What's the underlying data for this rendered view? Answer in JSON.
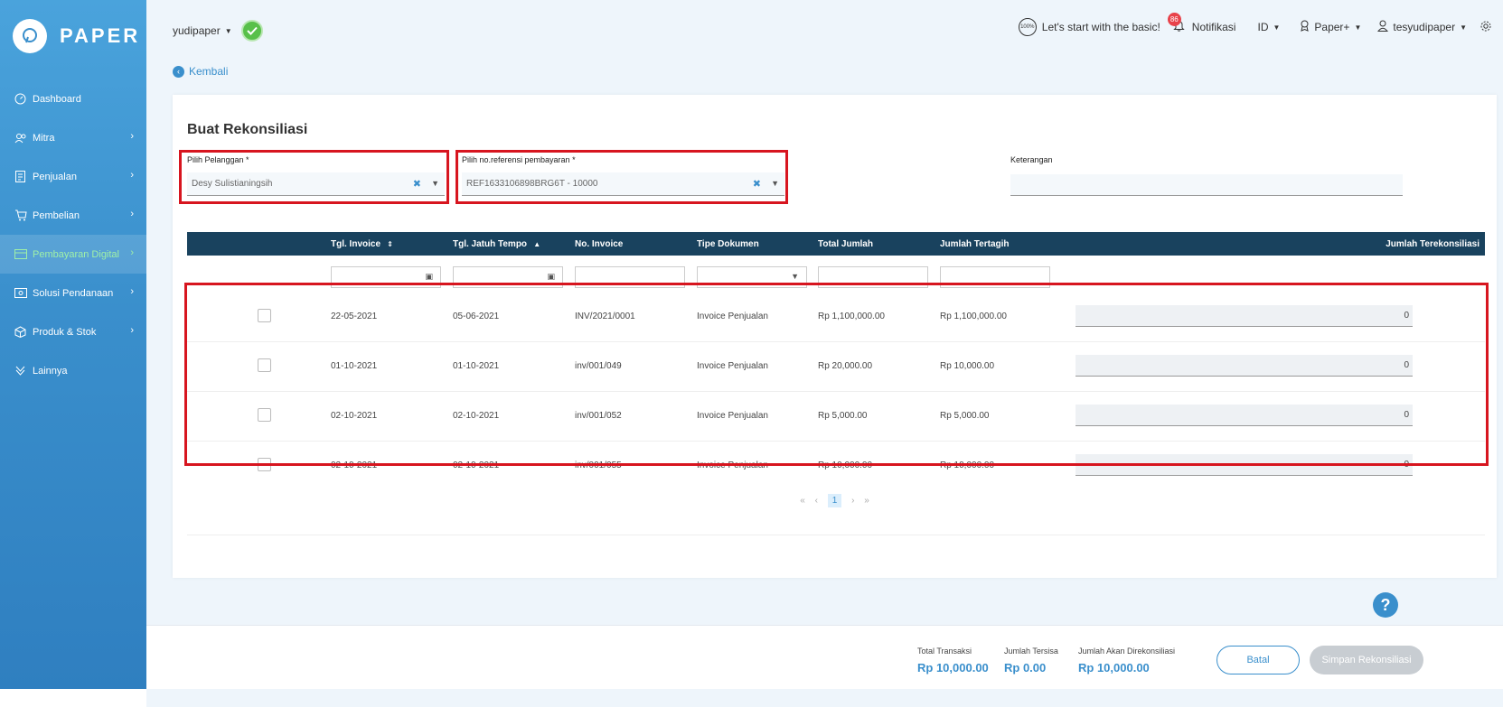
{
  "brand": {
    "name": "PAPER"
  },
  "sidebar": {
    "items": [
      {
        "label": "Dashboard"
      },
      {
        "label": "Mitra"
      },
      {
        "label": "Penjualan"
      },
      {
        "label": "Pembelian"
      },
      {
        "label": "Pembayaran Digital"
      },
      {
        "label": "Solusi Pendanaan"
      },
      {
        "label": "Produk & Stok"
      },
      {
        "label": "Lainnya"
      }
    ]
  },
  "header": {
    "company": "yudipaper",
    "basic_label": "Let's start with the basic!",
    "badge_text": "100%",
    "notif_count": "86",
    "notif_label": "Notifikasi",
    "lang": "ID",
    "plan": "Paper+",
    "user": "tesyudipaper"
  },
  "back_label": "Kembali",
  "form": {
    "title": "Buat Rekonsiliasi",
    "customer_label": "Pilih Pelanggan *",
    "customer_value": "Desy Sulistianingsih",
    "ref_label": "Pilih no.referensi pembayaran *",
    "ref_value": "REF1633106898BRG6T - 10000",
    "note_label": "Keterangan",
    "note_value": ""
  },
  "table": {
    "headers": {
      "tgl_invoice": "Tgl. Invoice",
      "jatuh_tempo": "Tgl. Jatuh Tempo",
      "no_invoice": "No. Invoice",
      "tipe": "Tipe Dokumen",
      "total": "Total Jumlah",
      "tertagih": "Jumlah Tertagih",
      "terekonsiliasi": "Jumlah Terekonsiliasi"
    },
    "rows": [
      {
        "tgl": "22-05-2021",
        "tempo": "05-06-2021",
        "no": "INV/2021/0001",
        "tipe": "Invoice Penjualan",
        "total": "Rp 1,100,000.00",
        "tertagih": "Rp 1,100,000.00",
        "rekon": "0"
      },
      {
        "tgl": "01-10-2021",
        "tempo": "01-10-2021",
        "no": "inv/001/049",
        "tipe": "Invoice Penjualan",
        "total": "Rp 20,000.00",
        "tertagih": "Rp 10,000.00",
        "rekon": "0"
      },
      {
        "tgl": "02-10-2021",
        "tempo": "02-10-2021",
        "no": "inv/001/052",
        "tipe": "Invoice Penjualan",
        "total": "Rp 5,000.00",
        "tertagih": "Rp 5,000.00",
        "rekon": "0"
      },
      {
        "tgl": "02-10-2021",
        "tempo": "02-10-2021",
        "no": "inv/001/055",
        "tipe": "Invoice Penjualan",
        "total": "Rp 10,000.00",
        "tertagih": "Rp 10,000.00",
        "rekon": "0"
      }
    ]
  },
  "pagination": {
    "first": "«",
    "prev": "‹",
    "current": "1",
    "next": "›",
    "last": "»"
  },
  "summary": {
    "total_label": "Total Transaksi",
    "total_value": "Rp 10,000.00",
    "sisa_label": "Jumlah Tersisa",
    "sisa_value": "Rp 0.00",
    "rekon_label": "Jumlah Akan Direkonsiliasi",
    "rekon_value": "Rp 10,000.00"
  },
  "buttons": {
    "cancel": "Batal",
    "save": "Simpan Rekonsiliasi"
  },
  "help": "?",
  "colors": {
    "primary": "#3a8fcc",
    "header_bg": "#19425e",
    "highlight": "#d7151f",
    "active_nav": "#9ff0a8"
  }
}
